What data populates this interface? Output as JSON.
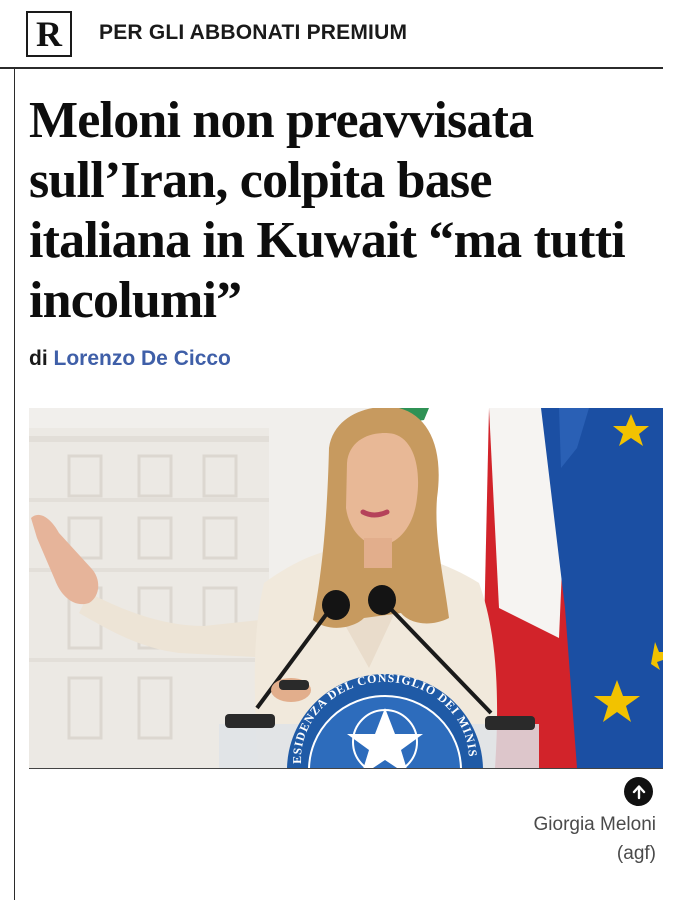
{
  "header": {
    "logo_letter": "R",
    "premium_label": "PER GLI ABBONATI PREMIUM"
  },
  "article": {
    "headline": "Meloni non preavvisata sull’Iran, colpita base italiana in Kuwait “ma tutti incolumi”",
    "byline_prefix": "di",
    "author": "Lorenzo De Cicco",
    "photo": {
      "caption": "Giorgia Meloni",
      "credit": "(agf)",
      "podium_text": "PRESIDENZA DEL CONSIGLIO DEI MINISTRI"
    }
  },
  "icons": {
    "scroll_up": "arrow-up-icon"
  },
  "colors": {
    "author_link": "#3f5fa8",
    "rules": "#2b2b2b",
    "podium_blue": "#1f5aa6",
    "eu_flag_blue": "#1b4fa3",
    "eu_star": "#f2c200",
    "italy_red": "#d2232a",
    "italy_green": "#1f8a4c"
  }
}
